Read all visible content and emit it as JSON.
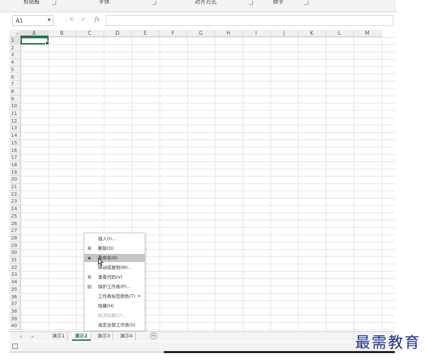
{
  "ribbon": {
    "groups": [
      "剪贴板",
      "字体",
      "对齐方式",
      "数字"
    ]
  },
  "formula_bar": {
    "name_box": "A1",
    "cancel_icon": "×",
    "enter_icon": "✓",
    "fx_label": "fx",
    "value": ""
  },
  "columns": [
    "A",
    "B",
    "C",
    "D",
    "E",
    "F",
    "G",
    "H",
    "I",
    "J",
    "K",
    "L",
    "M"
  ],
  "rows": [
    "1",
    "2",
    "3",
    "4",
    "5",
    "6",
    "7",
    "8",
    "9",
    "10",
    "11",
    "12",
    "13",
    "14",
    "15",
    "16",
    "17",
    "18",
    "19",
    "20",
    "21",
    "22",
    "23",
    "24",
    "25",
    "26",
    "27",
    "28",
    "29",
    "30",
    "31",
    "32",
    "33",
    "34",
    "35",
    "36",
    "37",
    "38",
    "39",
    "40"
  ],
  "active_cell": "A1",
  "context_menu": {
    "items": [
      {
        "label": "插入(I)...",
        "icon": "",
        "disabled": false,
        "submenu": false
      },
      {
        "label": "删除(D)",
        "icon": "delete-sheet-icon",
        "disabled": false,
        "submenu": false
      },
      {
        "label": "重命名(R)",
        "icon": "rename-icon",
        "disabled": false,
        "submenu": false,
        "hover": true
      },
      {
        "label": "移动或复制(M)...",
        "icon": "",
        "disabled": false,
        "submenu": false
      },
      {
        "label": "查看代码(V)",
        "icon": "view-code-icon",
        "disabled": false,
        "submenu": false
      },
      {
        "label": "保护工作表(P)...",
        "icon": "protect-sheet-icon",
        "disabled": false,
        "submenu": false
      },
      {
        "label": "工作表标签颜色(T)",
        "icon": "",
        "disabled": false,
        "submenu": true
      },
      {
        "label": "隐藏(H)",
        "icon": "",
        "disabled": false,
        "submenu": false
      },
      {
        "label": "取消隐藏(U)...",
        "icon": "",
        "disabled": true,
        "submenu": false
      },
      {
        "label": "选定全部工作表(S)",
        "icon": "",
        "disabled": false,
        "submenu": false
      }
    ]
  },
  "sheets": {
    "tabs": [
      "演示1",
      "演示2",
      "演示3",
      "演示4"
    ],
    "active": "演示2",
    "add_label": "+"
  },
  "watermark": "最需教育",
  "colors": {
    "accent": "#217346",
    "watermark": "#1f2d8c",
    "menu_hover": "#c6c6c6"
  }
}
